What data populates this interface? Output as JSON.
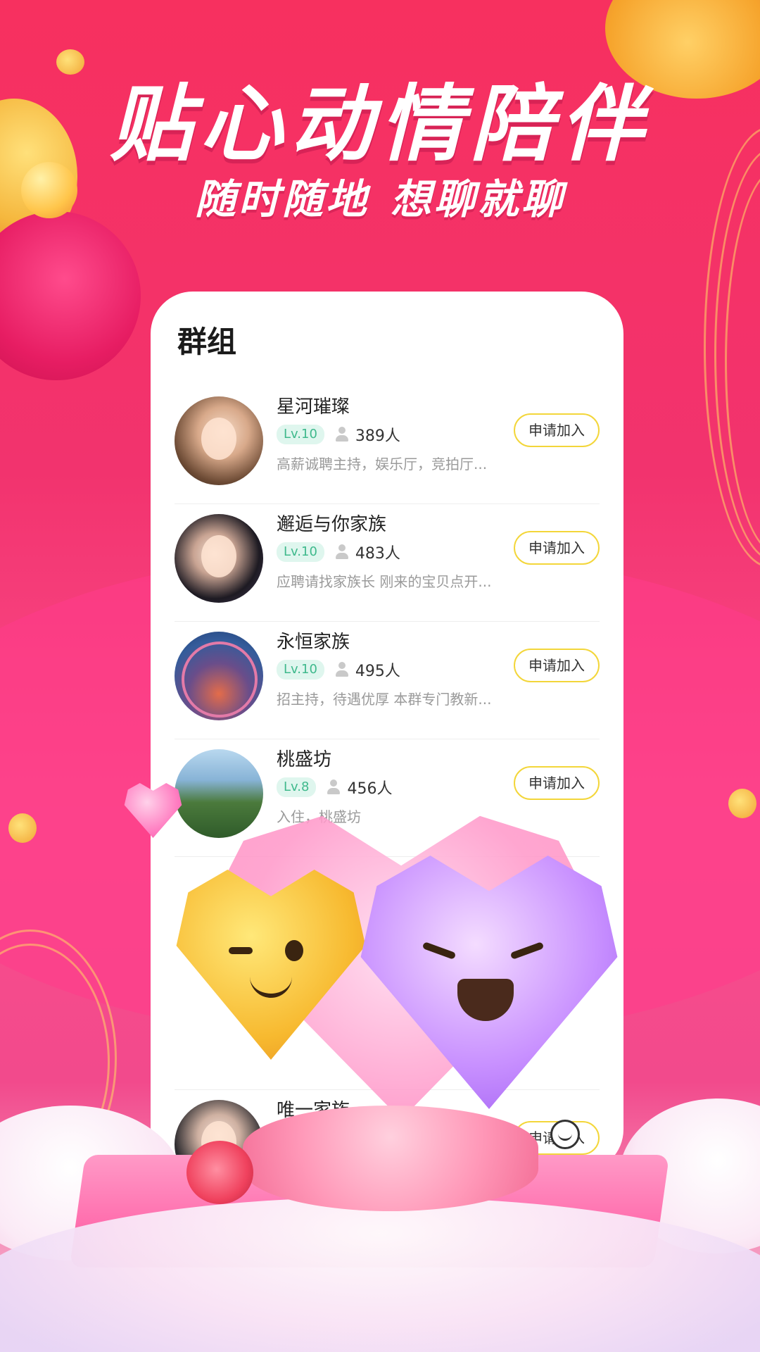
{
  "banner": {
    "headline": "贴心动情陪伴",
    "subline_part1": "随时随地",
    "subline_part2": "想聊就聊"
  },
  "screen": {
    "title": "群组",
    "groups": [
      {
        "name": "星河璀璨",
        "level": "Lv.10",
        "members": "389人",
        "description": "高薪诚聘主持，娱乐厅，竞拍厅...",
        "join_label": "申请加入"
      },
      {
        "name": "邂逅与你家族",
        "level": "Lv.10",
        "members": "483人",
        "description": "应聘请找家族长 刚来的宝贝点开...",
        "join_label": "申请加入"
      },
      {
        "name": "永恒家族",
        "level": "Lv.10",
        "members": "495人",
        "description": "招主持，待遇优厚 本群专门教新...",
        "join_label": "申请加入"
      },
      {
        "name": "桃盛坊",
        "level": "Lv.8",
        "members": "456人",
        "description": "入住，桃盛坊",
        "join_label": "申请加入"
      }
    ],
    "partial_group": {
      "name": "唯一家族",
      "join_label": "申请加入"
    }
  },
  "colors": {
    "background": "#f7305f",
    "join_border": "#f3d63a",
    "level_badge_bg": "#dff6ee",
    "level_badge_text": "#3fb98c"
  },
  "icons": {
    "member": "person-icon",
    "nav": "smile-icon"
  }
}
